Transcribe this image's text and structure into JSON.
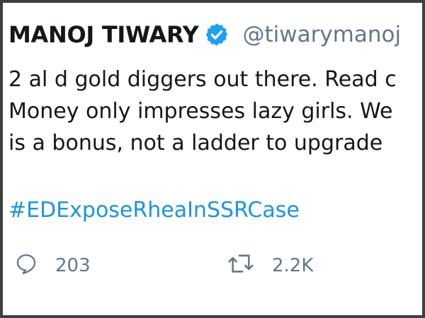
{
  "tweet": {
    "author_name": "MANOJ TIWARY",
    "handle": "@tiwarymanoj",
    "verified_icon": "verified-badge-icon",
    "text_lines": [
      "2 al d gold diggers out there. Read c",
      "Money only impresses lazy girls. We",
      "is a bonus, not a ladder to upgrade "
    ],
    "hashtag": "#EDExposeRheaInSSRCase"
  },
  "actions": {
    "reply_icon": "reply-bubble-icon",
    "reply_count": "203",
    "retweet_icon": "retweet-icon",
    "retweet_count": "2.2K"
  },
  "colors": {
    "verified": "#1da1f2",
    "hashtag": "#1b95e0",
    "text": "#14171a",
    "muted": "#657786",
    "frame_border": "#3f3f3f"
  }
}
